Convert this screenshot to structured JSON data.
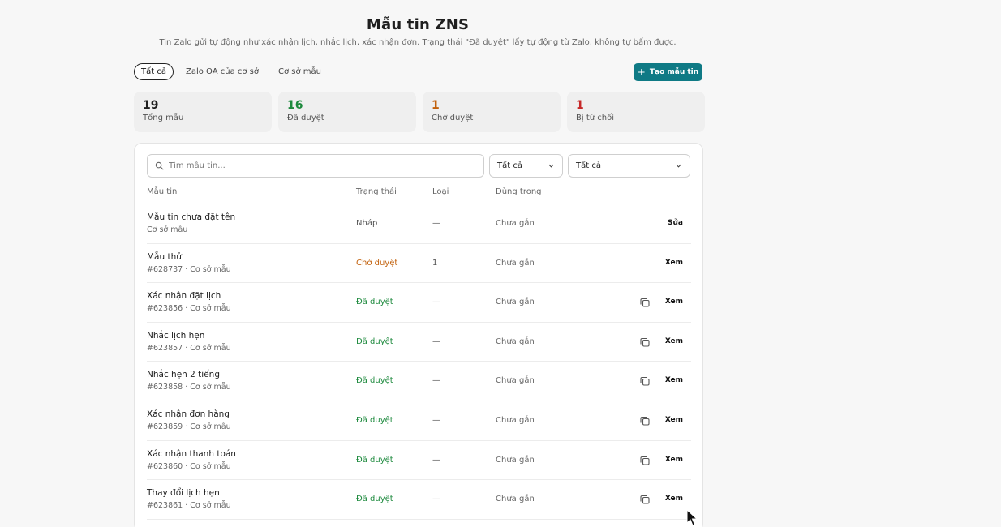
{
  "header": {
    "title": "Mẫu tin ZNS",
    "subtitle": "Tin Zalo gửi tự động như xác nhận lịch, nhắc lịch, xác nhận đơn. Trạng thái \"Đã duyệt\" lấy tự động từ Zalo, không tự bấm được."
  },
  "tabs": [
    {
      "label": "Tất cả",
      "active": true
    },
    {
      "label": "Zalo OA của cơ sở",
      "active": false
    },
    {
      "label": "Cơ sở mẫu",
      "active": false
    }
  ],
  "create_button": {
    "label": "Tạo mẫu tin",
    "icon": "plus-icon",
    "color": "#0f7a85"
  },
  "stats": [
    {
      "value": "19",
      "label": "Tổng mẫu",
      "color": "#1f1f1f"
    },
    {
      "value": "16",
      "label": "Đã duyệt",
      "color": "#1e8a3e"
    },
    {
      "value": "1",
      "label": "Chờ duyệt",
      "color": "#c2610c"
    },
    {
      "value": "1",
      "label": "Bị từ chối",
      "color": "#c62828"
    }
  ],
  "filters": {
    "search_placeholder": "Tìm mẫu tin...",
    "select1_value": "Tất cả",
    "select2_value": "Tất cả"
  },
  "table": {
    "headers": [
      "Mẫu tin",
      "Trạng thái",
      "Loại",
      "Dùng trong"
    ],
    "rows": [
      {
        "name": "Mẫu tin chưa đặt tên",
        "sub": "Cơ sở mẫu",
        "status": "Nháp",
        "status_kind": "draft",
        "type": "—",
        "used_in": "Chưa gắn",
        "copy": false,
        "action": "Sửa"
      },
      {
        "name": "Mẫu thử",
        "sub": "#628737 · Cơ sở mẫu",
        "status": "Chờ duyệt",
        "status_kind": "pending",
        "type": "1",
        "used_in": "Chưa gắn",
        "copy": false,
        "action": "Xem"
      },
      {
        "name": "Xác nhận đặt lịch",
        "sub": "#623856 · Cơ sở mẫu",
        "status": "Đã duyệt",
        "status_kind": "approved",
        "type": "—",
        "used_in": "Chưa gắn",
        "copy": true,
        "action": "Xem"
      },
      {
        "name": "Nhắc lịch hẹn",
        "sub": "#623857 · Cơ sở mẫu",
        "status": "Đã duyệt",
        "status_kind": "approved",
        "type": "—",
        "used_in": "Chưa gắn",
        "copy": true,
        "action": "Xem"
      },
      {
        "name": "Nhắc hẹn 2 tiếng",
        "sub": "#623858 · Cơ sở mẫu",
        "status": "Đã duyệt",
        "status_kind": "approved",
        "type": "—",
        "used_in": "Chưa gắn",
        "copy": true,
        "action": "Xem"
      },
      {
        "name": "Xác nhận đơn hàng",
        "sub": "#623859 · Cơ sở mẫu",
        "status": "Đã duyệt",
        "status_kind": "approved",
        "type": "—",
        "used_in": "Chưa gắn",
        "copy": true,
        "action": "Xem"
      },
      {
        "name": "Xác nhận thanh toán",
        "sub": "#623860 · Cơ sở mẫu",
        "status": "Đã duyệt",
        "status_kind": "approved",
        "type": "—",
        "used_in": "Chưa gắn",
        "copy": true,
        "action": "Xem"
      },
      {
        "name": "Thay đổi lịch hẹn",
        "sub": "#623861 · Cơ sở mẫu",
        "status": "Đã duyệt",
        "status_kind": "approved",
        "type": "—",
        "used_in": "Chưa gắn",
        "copy": true,
        "action": "Xem"
      }
    ]
  }
}
